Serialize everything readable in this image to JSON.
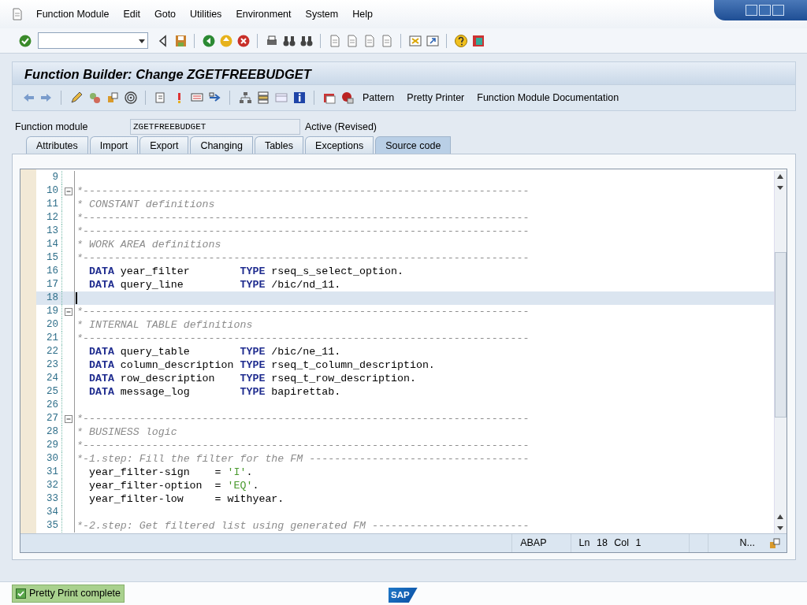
{
  "menu": [
    {
      "label": "Function Module"
    },
    {
      "label": "Edit"
    },
    {
      "label": "Goto"
    },
    {
      "label": "Utilities"
    },
    {
      "label": "Environment"
    },
    {
      "label": "System"
    },
    {
      "label": "Help"
    }
  ],
  "title": "Function Builder: Change ZGETFREEBUDGET",
  "app_toolbar_buttons": [
    "Pattern",
    "Pretty Printer",
    "Function Module Documentation"
  ],
  "function_module": {
    "label": "Function module",
    "value": "ZGETFREEBUDGET",
    "status": "Active (Revised)"
  },
  "tabs": [
    {
      "label": "Attributes",
      "selected": false
    },
    {
      "label": "Import",
      "selected": false
    },
    {
      "label": "Export",
      "selected": false
    },
    {
      "label": "Changing",
      "selected": false
    },
    {
      "label": "Tables",
      "selected": false
    },
    {
      "label": "Exceptions",
      "selected": false
    },
    {
      "label": "Source code",
      "selected": true
    }
  ],
  "code_lines": [
    {
      "no": "9",
      "fold": false,
      "current": false
    },
    {
      "no": "10",
      "fold": true,
      "current": false,
      "indent": false,
      "segments": [
        {
          "kind": "comment",
          "text": "*-----------------------------------------------------------------------"
        }
      ]
    },
    {
      "no": "11",
      "fold": false,
      "current": false,
      "indent": false,
      "segments": [
        {
          "kind": "comment",
          "text": "* CONSTANT definitions"
        }
      ]
    },
    {
      "no": "12",
      "fold": false,
      "current": false,
      "indent": false,
      "segments": [
        {
          "kind": "comment",
          "text": "*-----------------------------------------------------------------------"
        }
      ]
    },
    {
      "no": "13",
      "fold": false,
      "current": false,
      "indent": false,
      "segments": [
        {
          "kind": "comment",
          "text": "*-----------------------------------------------------------------------"
        }
      ]
    },
    {
      "no": "14",
      "fold": false,
      "current": false,
      "indent": false,
      "segments": [
        {
          "kind": "comment",
          "text": "* WORK AREA definitions"
        }
      ]
    },
    {
      "no": "15",
      "fold": false,
      "current": false,
      "indent": false,
      "segments": [
        {
          "kind": "comment",
          "text": "*-----------------------------------------------------------------------"
        }
      ]
    },
    {
      "no": "16",
      "fold": false,
      "current": false,
      "indent": true,
      "segments": [
        {
          "kind": "keyword",
          "text": "DATA"
        },
        {
          "kind": "plain",
          "text": " year_filter        "
        },
        {
          "kind": "keyword",
          "text": "TYPE"
        },
        {
          "kind": "plain",
          "text": " rseq_s_select_option."
        }
      ]
    },
    {
      "no": "17",
      "fold": false,
      "current": false,
      "indent": true,
      "segments": [
        {
          "kind": "keyword",
          "text": "DATA"
        },
        {
          "kind": "plain",
          "text": " query_line         "
        },
        {
          "kind": "keyword",
          "text": "TYPE"
        },
        {
          "kind": "plain",
          "text": " /bic/nd_11."
        }
      ]
    },
    {
      "no": "18",
      "fold": false,
      "current": true
    },
    {
      "no": "19",
      "fold": true,
      "current": false,
      "indent": false,
      "segments": [
        {
          "kind": "comment",
          "text": "*-----------------------------------------------------------------------"
        }
      ]
    },
    {
      "no": "20",
      "fold": false,
      "current": false,
      "indent": false,
      "segments": [
        {
          "kind": "comment",
          "text": "* INTERNAL TABLE definitions"
        }
      ]
    },
    {
      "no": "21",
      "fold": false,
      "current": false,
      "indent": false,
      "segments": [
        {
          "kind": "comment",
          "text": "*-----------------------------------------------------------------------"
        }
      ]
    },
    {
      "no": "22",
      "fold": false,
      "current": false,
      "indent": true,
      "segments": [
        {
          "kind": "keyword",
          "text": "DATA"
        },
        {
          "kind": "plain",
          "text": " query_table        "
        },
        {
          "kind": "keyword",
          "text": "TYPE"
        },
        {
          "kind": "plain",
          "text": " /bic/ne_11."
        }
      ]
    },
    {
      "no": "23",
      "fold": false,
      "current": false,
      "indent": true,
      "segments": [
        {
          "kind": "keyword",
          "text": "DATA"
        },
        {
          "kind": "plain",
          "text": " column_description "
        },
        {
          "kind": "keyword",
          "text": "TYPE"
        },
        {
          "kind": "plain",
          "text": " rseq_t_column_description."
        }
      ]
    },
    {
      "no": "24",
      "fold": false,
      "current": false,
      "indent": true,
      "segments": [
        {
          "kind": "keyword",
          "text": "DATA"
        },
        {
          "kind": "plain",
          "text": " row_description    "
        },
        {
          "kind": "keyword",
          "text": "TYPE"
        },
        {
          "kind": "plain",
          "text": " rseq_t_row_description."
        }
      ]
    },
    {
      "no": "25",
      "fold": false,
      "current": false,
      "indent": true,
      "segments": [
        {
          "kind": "keyword",
          "text": "DATA"
        },
        {
          "kind": "plain",
          "text": " message_log        "
        },
        {
          "kind": "keyword",
          "text": "TYPE"
        },
        {
          "kind": "plain",
          "text": " bapirettab."
        }
      ]
    },
    {
      "no": "26",
      "fold": false,
      "current": false
    },
    {
      "no": "27",
      "fold": true,
      "current": false,
      "indent": false,
      "segments": [
        {
          "kind": "comment",
          "text": "*-----------------------------------------------------------------------"
        }
      ]
    },
    {
      "no": "28",
      "fold": false,
      "current": false,
      "indent": false,
      "segments": [
        {
          "kind": "comment",
          "text": "* BUSINESS logic"
        }
      ]
    },
    {
      "no": "29",
      "fold": false,
      "current": false,
      "indent": false,
      "segments": [
        {
          "kind": "comment",
          "text": "*-----------------------------------------------------------------------"
        }
      ]
    },
    {
      "no": "30",
      "fold": false,
      "current": false,
      "indent": false,
      "segments": [
        {
          "kind": "comment",
          "text": "*-1.step: Fill the filter for the FM -----------------------------------"
        }
      ]
    },
    {
      "no": "31",
      "fold": false,
      "current": false,
      "indent": true,
      "segments": [
        {
          "kind": "plain",
          "text": "year_filter-sign    = "
        },
        {
          "kind": "string",
          "text": "'I'"
        },
        {
          "kind": "plain",
          "text": "."
        }
      ]
    },
    {
      "no": "32",
      "fold": false,
      "current": false,
      "indent": true,
      "segments": [
        {
          "kind": "plain",
          "text": "year_filter-option  = "
        },
        {
          "kind": "string",
          "text": "'EQ'"
        },
        {
          "kind": "plain",
          "text": "."
        }
      ]
    },
    {
      "no": "33",
      "fold": false,
      "current": false,
      "indent": true,
      "segments": [
        {
          "kind": "plain",
          "text": "year_filter-low     = withyear."
        }
      ]
    },
    {
      "no": "34",
      "fold": false,
      "current": false
    },
    {
      "no": "35",
      "fold": false,
      "current": false,
      "indent": false,
      "segments": [
        {
          "kind": "comment",
          "text": "*-2.step: Get filtered list using generated FM -------------------------"
        }
      ]
    }
  ],
  "editor_status": {
    "language": "ABAP",
    "position": "Ln 18 Col 1",
    "column_3": "N..."
  },
  "status_message": "Pretty Print complete",
  "logo": "SAP"
}
